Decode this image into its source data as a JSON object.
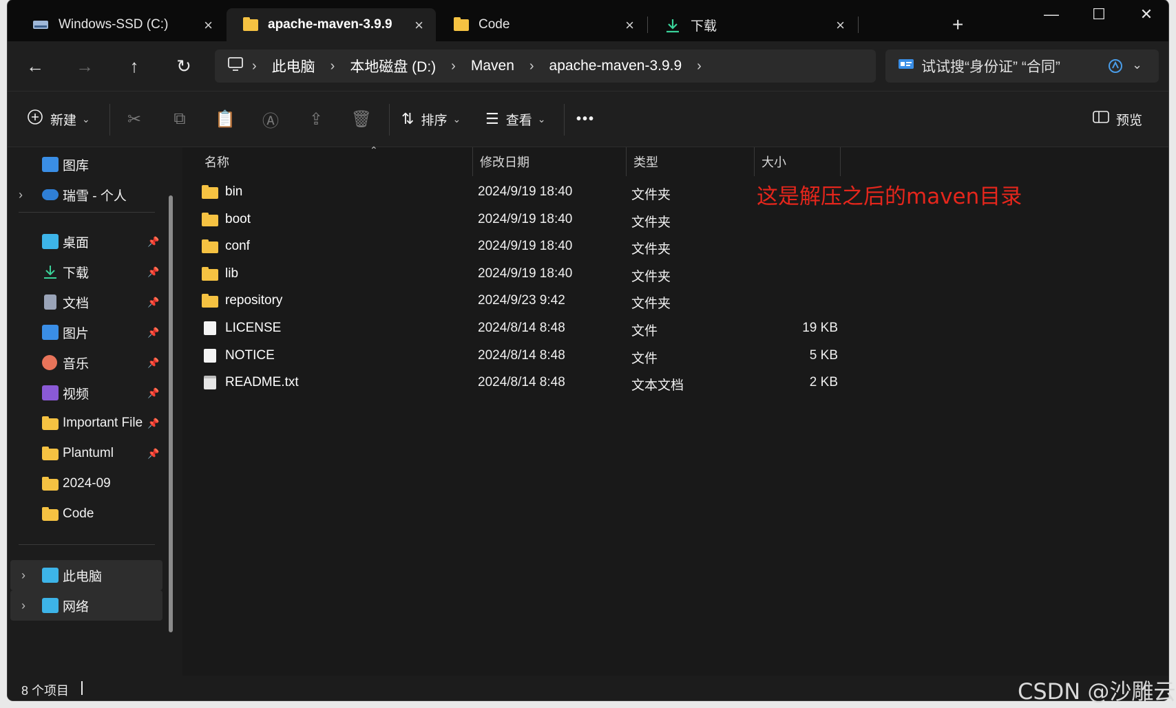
{
  "tabs": [
    {
      "label": "Windows-SSD (C:)",
      "icon": "drive-icon"
    },
    {
      "label": "apache-maven-3.9.9",
      "icon": "folder-icon"
    },
    {
      "label": "Code",
      "icon": "folder-icon"
    },
    {
      "label": "下载",
      "icon": "download-icon"
    }
  ],
  "tab_close": "×",
  "new_tab": "+",
  "window": {
    "minimize": "—",
    "maximize": "☐",
    "close": "✕"
  },
  "nav": {
    "back": "←",
    "forward": "→",
    "up": "↑",
    "refresh": "↻"
  },
  "breadcrumb": [
    "此电脑",
    "本地磁盘 (D:)",
    "Maven",
    "apache-maven-3.9.9"
  ],
  "search": {
    "placeholder": "试试搜“身份证” “合同”"
  },
  "commands": {
    "new": "新建",
    "sort": "排序",
    "view": "查看",
    "more": "•••",
    "preview": "预览"
  },
  "sidebar": {
    "top": [
      {
        "label": "图库",
        "icon": "gallery-icon",
        "color": "#3a8ee6"
      },
      {
        "label": "瑞雪 - 个人",
        "icon": "onedrive-icon",
        "color": "#2f7fd6"
      }
    ],
    "pinned": [
      {
        "label": "桌面",
        "icon": "desktop-icon",
        "color": "#3db4e8"
      },
      {
        "label": "下载",
        "icon": "download-icon",
        "color": "#3ad39a"
      },
      {
        "label": "文档",
        "icon": "document-icon",
        "color": "#9aa4b8"
      },
      {
        "label": "图片",
        "icon": "pictures-icon",
        "color": "#3a8ee6"
      },
      {
        "label": "音乐",
        "icon": "music-icon",
        "color": "#e8745a"
      },
      {
        "label": "视频",
        "icon": "video-icon",
        "color": "#8a5ad6"
      },
      {
        "label": "Important File",
        "icon": "folder-icon",
        "color": "#f5c242"
      },
      {
        "label": "Plantuml",
        "icon": "folder-icon",
        "color": "#f5c242"
      },
      {
        "label": "2024-09",
        "icon": "folder-icon",
        "color": "#f5c242"
      },
      {
        "label": "Code",
        "icon": "folder-icon",
        "color": "#f5c242"
      }
    ],
    "bottom": [
      {
        "label": "此电脑",
        "icon": "this-pc-icon",
        "color": "#3db4e8"
      },
      {
        "label": "网络",
        "icon": "network-icon",
        "color": "#3db4e8"
      }
    ]
  },
  "columns": {
    "name": "名称",
    "date": "修改日期",
    "type": "类型",
    "size": "大小"
  },
  "files": [
    {
      "name": "bin",
      "date": "2024/9/19 18:40",
      "type": "文件夹",
      "size": "",
      "kind": "folder"
    },
    {
      "name": "boot",
      "date": "2024/9/19 18:40",
      "type": "文件夹",
      "size": "",
      "kind": "folder"
    },
    {
      "name": "conf",
      "date": "2024/9/19 18:40",
      "type": "文件夹",
      "size": "",
      "kind": "folder"
    },
    {
      "name": "lib",
      "date": "2024/9/19 18:40",
      "type": "文件夹",
      "size": "",
      "kind": "folder"
    },
    {
      "name": "repository",
      "date": "2024/9/23 9:42",
      "type": "文件夹",
      "size": "",
      "kind": "folder"
    },
    {
      "name": "LICENSE",
      "date": "2024/8/14 8:48",
      "type": "文件",
      "size": "19 KB",
      "kind": "file"
    },
    {
      "name": "NOTICE",
      "date": "2024/8/14 8:48",
      "type": "文件",
      "size": "5 KB",
      "kind": "file"
    },
    {
      "name": "README.txt",
      "date": "2024/8/14 8:48",
      "type": "文本文档",
      "size": "2 KB",
      "kind": "text"
    }
  ],
  "annotation": "这是解压之后的maven目录",
  "status": {
    "count": "8 个项目"
  },
  "watermark": "CSDN @沙雕云"
}
